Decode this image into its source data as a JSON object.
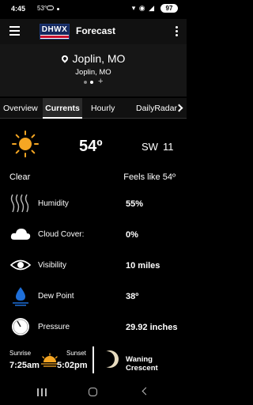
{
  "status_bar": {
    "time": "4:45",
    "temp": "53°",
    "right_icons": "▾ ◉ ◢",
    "battery": "97"
  },
  "app_bar": {
    "logo_text": "DHWX",
    "title": "Forecast"
  },
  "location": {
    "title": "Joplin, MO",
    "subtitle": "Joplin, MO",
    "add_label": "+"
  },
  "tabs": [
    {
      "label": "Overview"
    },
    {
      "label": "Currents"
    },
    {
      "label": "Hourly"
    },
    {
      "label": "DailyRadar"
    }
  ],
  "active_tab": "Currents",
  "current": {
    "temperature": "54º",
    "wind_dir": "SW",
    "wind_speed": "11",
    "condition": "Clear",
    "feels_like": "Feels like 54º"
  },
  "metrics": [
    {
      "label": "Humidity",
      "value": "55%",
      "icon": "humidity-icon"
    },
    {
      "label": "Cloud Cover:",
      "value": "0%",
      "icon": "cloud-icon"
    },
    {
      "label": "Visibility",
      "value": "10 miles",
      "icon": "eye-icon"
    },
    {
      "label": "Dew Point",
      "value": "38º",
      "icon": "dew-point-icon"
    },
    {
      "label": "Pressure",
      "value": "29.92 inches",
      "icon": "pressure-gauge-icon"
    }
  ],
  "astro": {
    "sunrise_label": "Sunrise",
    "sunset_label": "Sunset",
    "sunrise_time": "7:25am",
    "sunset_time": "5:02pm",
    "moon_phase": "Waning Crescent"
  },
  "colors": {
    "sun": "#f5a623",
    "dew_blue": "#1e6fd9",
    "background": "#000000",
    "panel": "#161616"
  }
}
